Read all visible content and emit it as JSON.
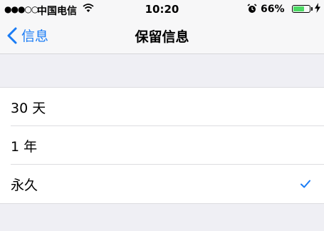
{
  "status_bar": {
    "signal": "●●●○○",
    "carrier": "中国电信",
    "wifi_icon": "wifi-icon",
    "time": "10:20",
    "alarm_icon": "alarm-clock-icon",
    "battery_percent": "66%",
    "battery_level": 0.66,
    "charging_icon": "lightning-bolt-icon",
    "battery_color": "#4cd964"
  },
  "nav": {
    "back_label": "信息",
    "back_icon": "chevron-left-icon",
    "title": "保留信息",
    "accent_color": "#1a7cf5"
  },
  "options": [
    {
      "label": "30 天",
      "selected": false
    },
    {
      "label": "1 年",
      "selected": false
    },
    {
      "label": "永久",
      "selected": true
    }
  ],
  "check_icon": "checkmark-icon"
}
